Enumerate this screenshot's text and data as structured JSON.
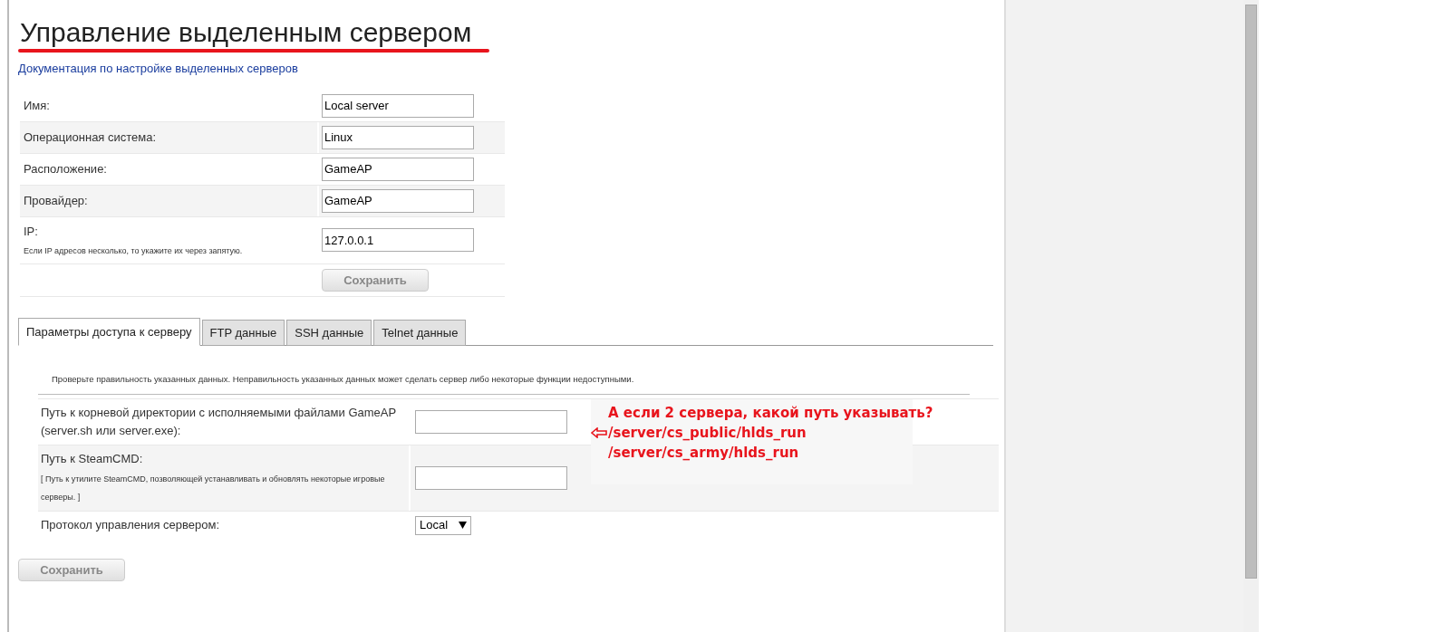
{
  "page": {
    "title": "Управление выделенным сервером",
    "doc_link": "Документация по настройке выделенных серверов"
  },
  "server_form": {
    "fields": [
      {
        "label": "Имя:",
        "value": "Local server"
      },
      {
        "label": "Операционная система:",
        "value": "Linux"
      },
      {
        "label": "Расположение:",
        "value": "GameAP"
      },
      {
        "label": "Провайдер:",
        "value": "GameAP"
      },
      {
        "label": "IP:",
        "hint": "Если IP адресов несколько, то укажите их через запятую.",
        "value": "127.0.0.1"
      }
    ],
    "save_button": "Сохранить"
  },
  "tabs": [
    {
      "label": "Параметры доступа к серверу",
      "selected": true
    },
    {
      "label": "FTP данные",
      "selected": false
    },
    {
      "label": "SSH данные",
      "selected": false
    },
    {
      "label": "Telnet данные",
      "selected": false
    }
  ],
  "access_panel": {
    "notice": "Проверьте правильность указанных данных. Неправильность указанных данных может сделать сервер либо некоторые функции недоступными.",
    "fields": [
      {
        "kind": "text",
        "label": "Путь к корневой директории с исполняемыми файлами GameAP (server.sh или server.exe):"
      },
      {
        "kind": "text",
        "label": "Путь к SteamCMD:",
        "hint": "[ Путь к утилите SteamCMD, позволяющей устанавливать и обновлять некоторые игровые серверы. ]"
      },
      {
        "kind": "select",
        "label": "Протокол управления сервером:",
        "value": "Local"
      }
    ],
    "save_button": "Сохранить"
  },
  "annotation": {
    "lines": [
      "А если 2 сервера, какой путь указывать?",
      "/server/cs_public/hlds_run",
      "/server/cs_army/hlds_run"
    ]
  }
}
